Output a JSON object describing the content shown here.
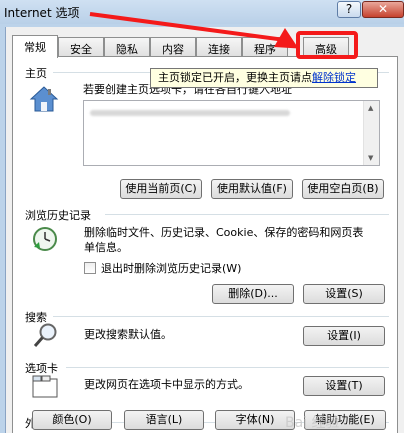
{
  "window": {
    "title": "Internet 选项",
    "help_label": "?",
    "close_label": "✕"
  },
  "tabs": [
    "常规",
    "安全",
    "隐私",
    "内容",
    "连接",
    "程序",
    "高级"
  ],
  "home": {
    "label": "主页",
    "description": "若要创建主页选项卡，请在各自行键入地址",
    "buttons": [
      "使用当前页(C)",
      "使用默认值(F)",
      "使用空白页(B)"
    ],
    "icon": "house-icon"
  },
  "tooltip": {
    "text": "主页锁定已开启，更换主页请点",
    "link": "解除锁定"
  },
  "history": {
    "label": "浏览历史记录",
    "description": "删除临时文件、历史记录、Cookie、保存的密码和网页表单信息。",
    "checkbox_label": "退出时删除浏览历史记录(W)",
    "checkbox_checked": false,
    "delete_button": "删除(D)...",
    "settings_button": "设置(S)",
    "icon": "history-clock-icon"
  },
  "search": {
    "label": "搜索",
    "description": "更改搜索默认值。",
    "settings_button": "设置(I)",
    "icon": "magnifier-icon"
  },
  "tabs_section": {
    "label": "选项卡",
    "description": "更改网页在选项卡中显示的方式。",
    "settings_button": "设置(T)",
    "icon": "tabs-window-icon"
  },
  "appearance": {
    "label": "外观",
    "buttons": [
      "颜色(O)",
      "语言(L)",
      "字体(N)",
      "辅助功能(E)"
    ]
  },
  "annotation": {
    "color": "#f41a1a"
  },
  "watermark": "Bai 经验"
}
